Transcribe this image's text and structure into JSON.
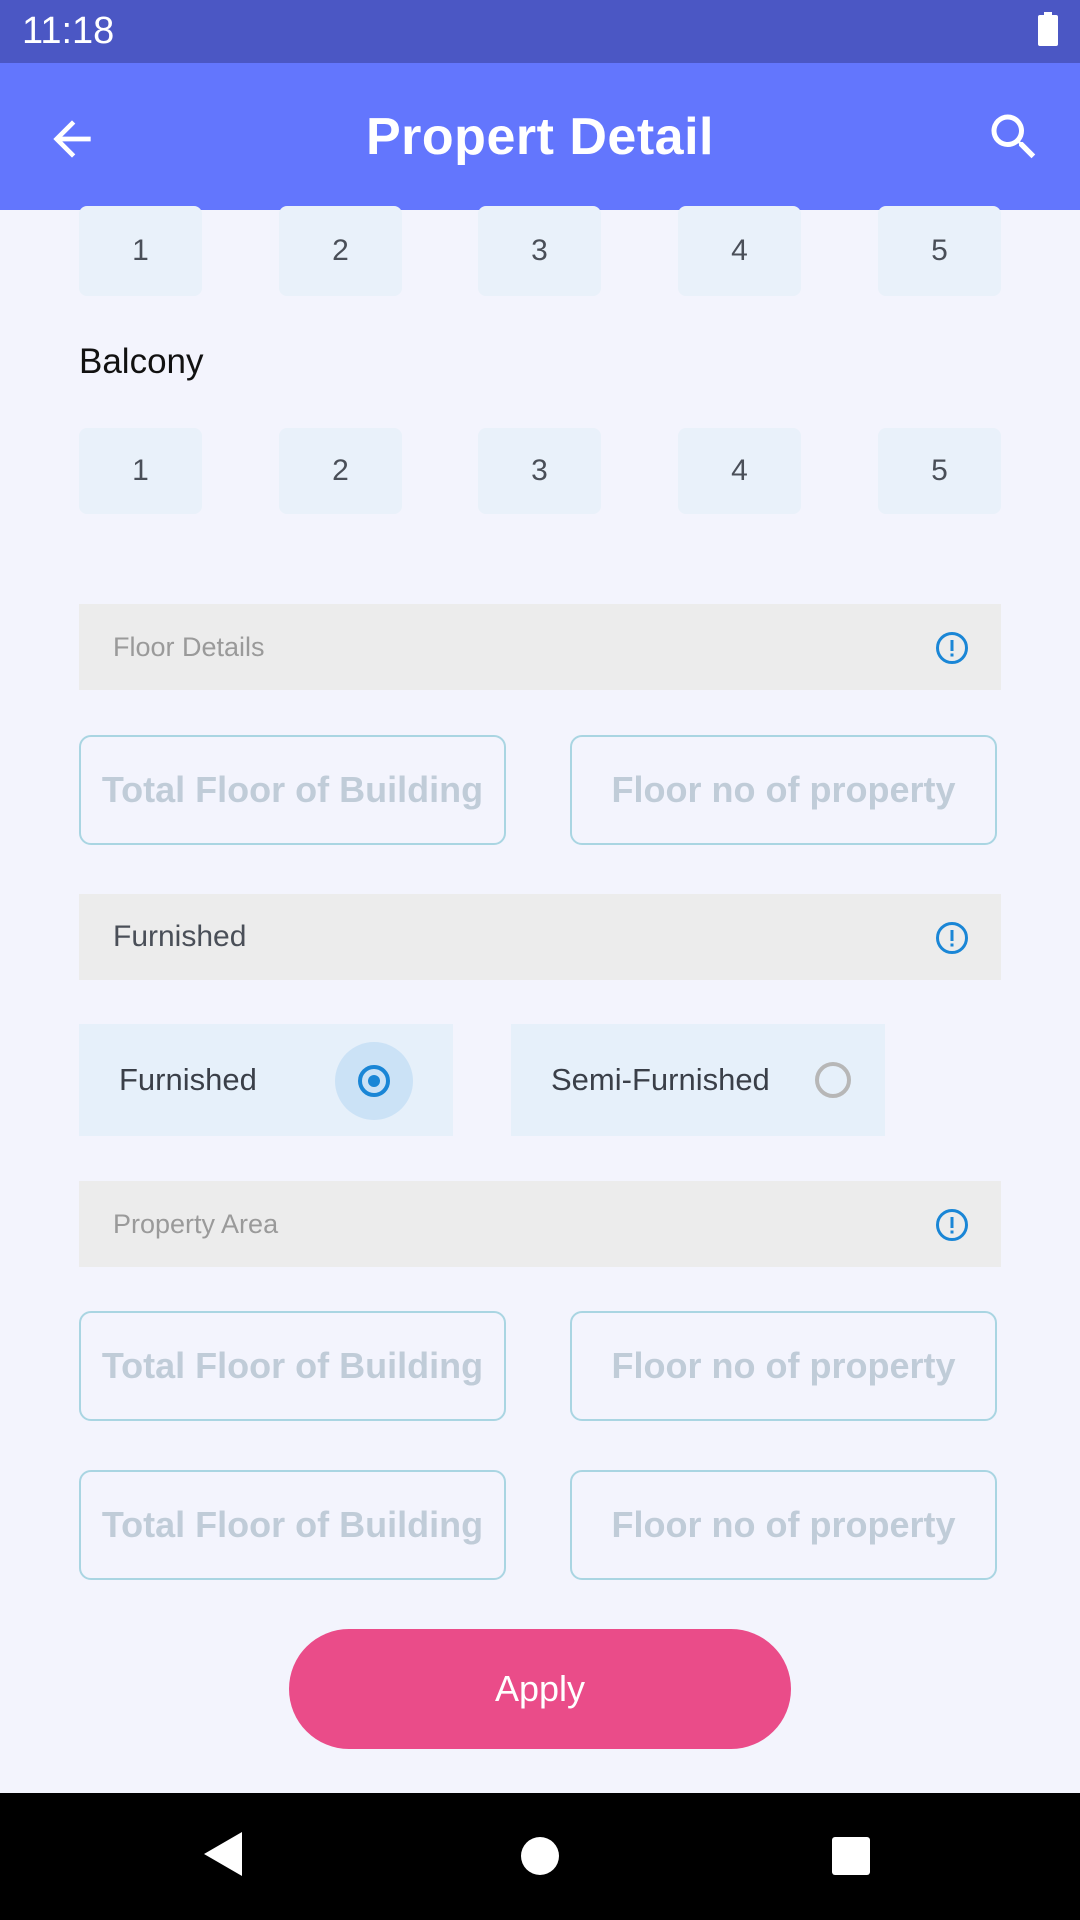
{
  "status": {
    "time": "11:18",
    "battery_icon": "battery-full-icon"
  },
  "app_bar": {
    "title": "Propert Detail",
    "back_icon": "arrow-left-icon",
    "search_icon": "search-icon"
  },
  "bathroom_options": [
    "1",
    "2",
    "3",
    "4",
    "5"
  ],
  "balcony": {
    "label": "Balcony",
    "options": [
      "1",
      "2",
      "3",
      "4",
      "5"
    ]
  },
  "floor_details": {
    "header": "Floor Details",
    "total_floor_placeholder": "Total Floor of Building",
    "floor_no_placeholder": "Floor no of property"
  },
  "furnished": {
    "header": "Furnished",
    "options": [
      {
        "label": "Furnished",
        "selected": true
      },
      {
        "label": "Semi-Furnished",
        "selected": false
      }
    ]
  },
  "property_area": {
    "header": "Property Area",
    "row1_left_placeholder": "Total Floor of Building",
    "row1_right_placeholder": "Floor no of property",
    "row2_left_placeholder": "Total Floor of Building",
    "row2_right_placeholder": "Floor no of property"
  },
  "apply_label": "Apply",
  "colors": {
    "status_bar": "#4b57c4",
    "app_bar": "#6376fd",
    "apply_button": "#ea4c89",
    "radio_selected": "#1a86d6",
    "info_icon": "#1a86d6"
  }
}
